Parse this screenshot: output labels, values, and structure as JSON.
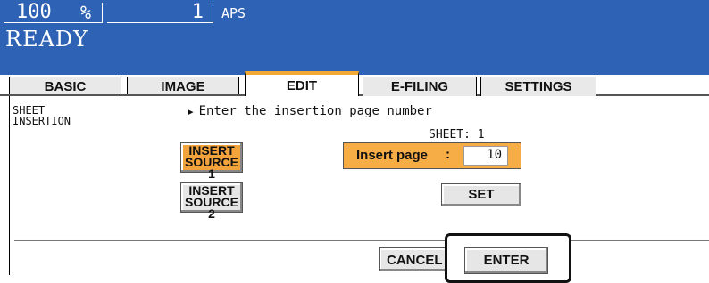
{
  "status": {
    "zoom_value": "100",
    "zoom_unit": "%",
    "copies": "1",
    "paper_mode": "APS",
    "machine_state": "READY"
  },
  "tabs": [
    {
      "label": "BASIC"
    },
    {
      "label": "IMAGE"
    },
    {
      "label": "EDIT"
    },
    {
      "label": "E-FILING"
    },
    {
      "label": "SETTINGS"
    }
  ],
  "function": {
    "title_line1": "SHEET",
    "title_line2": "INSERTION"
  },
  "instruction": "Enter the insertion page number",
  "sheet_indicator": "SHEET: 1",
  "buttons": {
    "insert1_l1": "INSERT",
    "insert1_l2": "SOURCE 1",
    "insert2_l1": "INSERT",
    "insert2_l2": "SOURCE 2",
    "set": "SET",
    "cancel": "CANCEL",
    "enter": "ENTER"
  },
  "insert_page": {
    "label": "Insert page",
    "separator": ":",
    "value": "10"
  },
  "colors": {
    "status_bar": "#2e62b4",
    "active_tab_accent": "#f3a935",
    "selected_button": "#f2a33c"
  }
}
